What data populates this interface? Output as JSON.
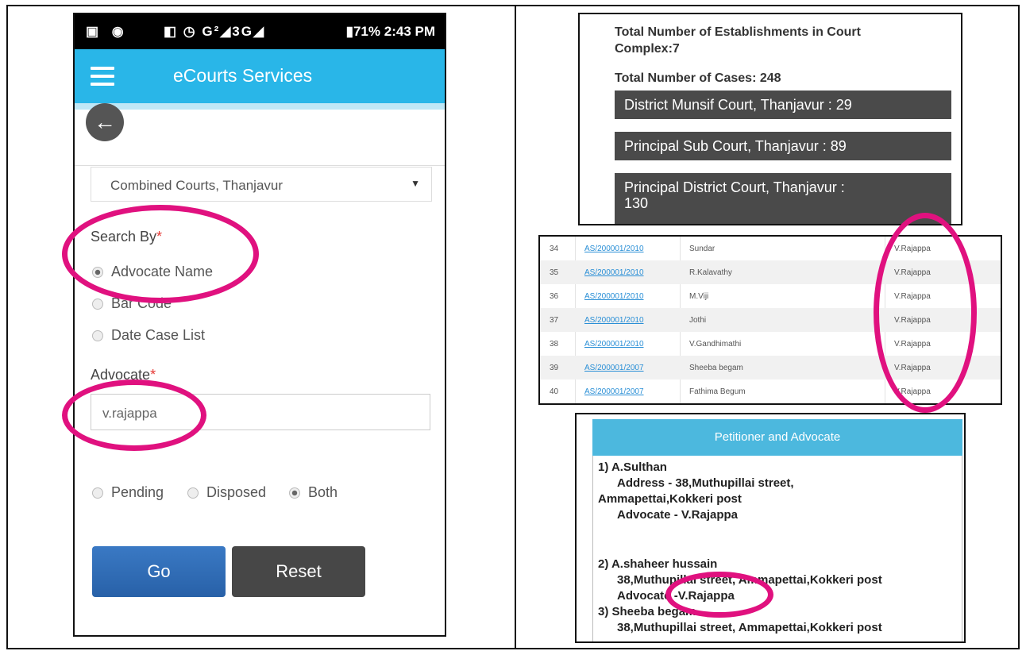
{
  "phone": {
    "status": {
      "left": "▣ ◉",
      "middle": "◧ ◷ G²◢3G◢",
      "battery": "▮71%",
      "time": "2:43 PM"
    },
    "app_title": "eCourts Services",
    "court_select": "Combined Courts, Thanjavur",
    "search_by_label": "Search By",
    "search_options": [
      {
        "label": "Advocate Name",
        "selected": true
      },
      {
        "label": "Bar Code",
        "selected": false
      },
      {
        "label": "Date Case List",
        "selected": false
      }
    ],
    "advocate_label": "Advocate",
    "advocate_value": "v.rajappa",
    "status_options": [
      {
        "label": "Pending",
        "selected": false
      },
      {
        "label": "Disposed",
        "selected": false
      },
      {
        "label": "Both",
        "selected": true
      }
    ],
    "go_label": "Go",
    "reset_label": "Reset",
    "required_mark": "*"
  },
  "establishments": {
    "total_establishments_line1": "Total Number of Establishments in Court",
    "total_establishments_line2": "Complex:7",
    "total_cases": "Total Number of Cases: 248",
    "courts": [
      "District Munsif Court, Thanjavur : 29",
      "Principal Sub Court, Thanjavur : 89",
      "Principal District Court, Thanjavur :",
      "130"
    ]
  },
  "cases_table": {
    "rows": [
      {
        "no": "34",
        "case": "AS/200001/2010",
        "party": "Sundar",
        "advocate": "V.Rajappa"
      },
      {
        "no": "35",
        "case": "AS/200001/2010",
        "party": "R.Kalavathy",
        "advocate": "V.Rajappa"
      },
      {
        "no": "36",
        "case": "AS/200001/2010",
        "party": "M.Viji",
        "advocate": "V.Rajappa"
      },
      {
        "no": "37",
        "case": "AS/200001/2010",
        "party": "Jothi",
        "advocate": "V.Rajappa"
      },
      {
        "no": "38",
        "case": "AS/200001/2010",
        "party": "V.Gandhimathi",
        "advocate": "V.Rajappa"
      },
      {
        "no": "39",
        "case": "AS/200001/2007",
        "party": "Sheeba begam",
        "advocate": "V.Rajappa"
      },
      {
        "no": "40",
        "case": "AS/200001/2007",
        "party": "Fathima Begum",
        "advocate": "V.Rajappa"
      }
    ]
  },
  "petitioner": {
    "header": "Petitioner and Advocate",
    "lines": [
      "1) A.Sulthan",
      "Address - 38,Muthupillai street,",
      "Ammapettai,Kokkeri post",
      "Advocate - V.Rajappa",
      "2) A.shaheer hussain",
      "38,Muthupillai street, Ammapettai,Kokkeri post",
      "Advocate -V.Rajappa",
      "3) Sheeba begam",
      "38,Muthupillai street, Ammapettai,Kokkeri post"
    ]
  },
  "colors": {
    "app_bar": "#29b6e8",
    "highlight": "#e0117f",
    "go_button": "#2f6db6",
    "reset_button": "#474747",
    "court_button": "#4a4a4a",
    "table_header": "#4cb8de"
  }
}
